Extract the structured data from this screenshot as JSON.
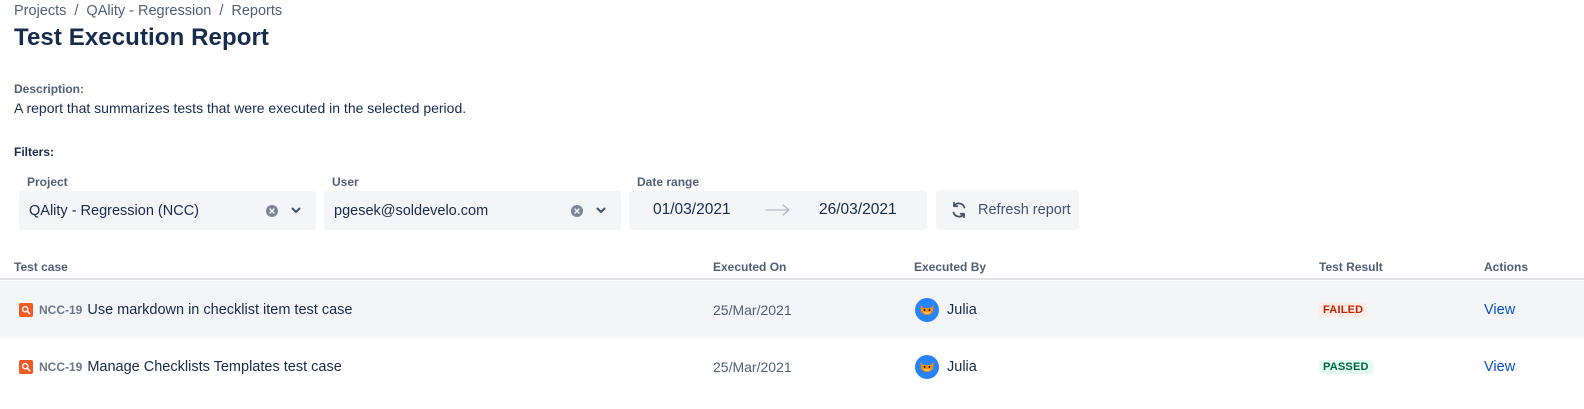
{
  "breadcrumb": [
    {
      "label": "Projects"
    },
    {
      "label": "QAlity - Regression"
    },
    {
      "label": "Reports"
    }
  ],
  "breadcrumb_separator": "/",
  "page": {
    "title": "Test Execution Report"
  },
  "description": {
    "label": "Description:",
    "text": "A report that summarizes tests that were executed in the selected period."
  },
  "filters": {
    "label": "Filters:",
    "project": {
      "label": "Project",
      "value": "QAlity - Regression (NCC)"
    },
    "user": {
      "label": "User",
      "value": "pgesek@soldevelo.com"
    },
    "date_range": {
      "label": "Date range",
      "from": "01/03/2021",
      "to": "26/03/2021"
    },
    "refresh_label": "Refresh report"
  },
  "table": {
    "columns": [
      "Test case",
      "Executed On",
      "Executed By",
      "Test Result",
      "Actions"
    ],
    "rows": [
      {
        "key": "NCC-19",
        "summary": "Use markdown in checklist item test case",
        "executed_on": "25/Mar/2021",
        "executed_by": "Julia",
        "result": "FAILED",
        "action": "View"
      },
      {
        "key": "NCC-19",
        "summary": "Manage Checklists Templates test case",
        "executed_on": "25/Mar/2021",
        "executed_by": "Julia",
        "result": "PASSED",
        "action": "View"
      }
    ]
  },
  "colors": {
    "title_text": "#172b4d",
    "subtle_text": "#505f79",
    "field_background": "#f4f5f7",
    "link": "#0052cc",
    "failed_background": "#ffebe6",
    "failed_text": "#bf2600",
    "passed_background": "#e3fcef",
    "passed_text": "#006644",
    "test_icon": "#f15a24"
  },
  "icons": {
    "test_case": "magnifier-icon",
    "avatar": "fox-avatar",
    "refresh": "refresh-icon",
    "clear": "clear-icon",
    "chevron": "chevron-down-icon",
    "arrow": "arrow-right-icon"
  }
}
